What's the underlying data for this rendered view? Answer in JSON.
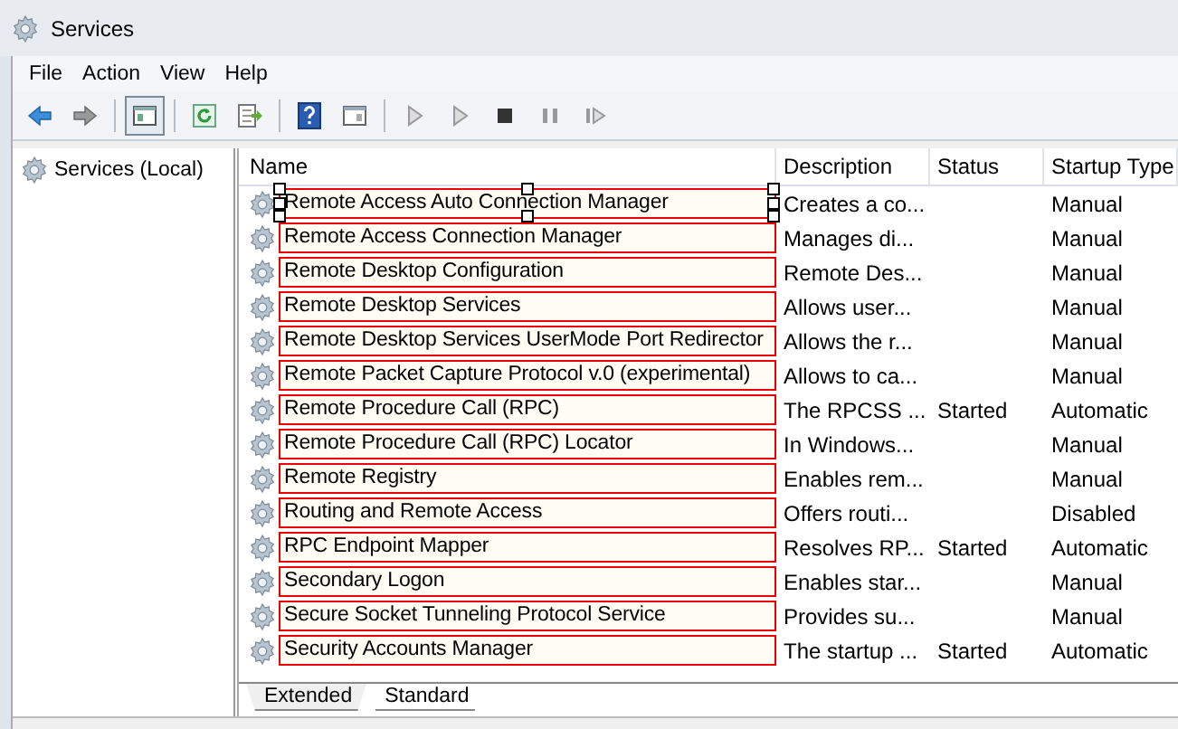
{
  "window": {
    "title": "Services"
  },
  "menu": [
    "File",
    "Action",
    "View",
    "Help"
  ],
  "toolbar": [
    {
      "kind": "back",
      "pressed": false
    },
    {
      "kind": "forward",
      "pressed": false
    },
    {
      "kind": "sep"
    },
    {
      "kind": "tree",
      "pressed": true
    },
    {
      "kind": "sep"
    },
    {
      "kind": "refresh",
      "pressed": false
    },
    {
      "kind": "export",
      "pressed": false
    },
    {
      "kind": "sep"
    },
    {
      "kind": "help",
      "pressed": false
    },
    {
      "kind": "panel",
      "pressed": false
    },
    {
      "kind": "sep"
    },
    {
      "kind": "play",
      "pressed": false
    },
    {
      "kind": "play",
      "pressed": false
    },
    {
      "kind": "stop",
      "pressed": false
    },
    {
      "kind": "pause",
      "pressed": false
    },
    {
      "kind": "restart",
      "pressed": false
    }
  ],
  "sidebar": {
    "items": [
      {
        "label": "Services (Local)",
        "selected": false
      }
    ]
  },
  "table": {
    "columns": [
      "Name",
      "Description",
      "Status",
      "Startup Type"
    ],
    "rows": [
      {
        "name": "Remote Access Auto Connection Manager",
        "description": "Creates a co...",
        "status": "",
        "startup": "Manual",
        "outlined": true,
        "selected": true
      },
      {
        "name": "Remote Access Connection Manager",
        "description": "Manages di...",
        "status": "",
        "startup": "Manual",
        "outlined": true,
        "selected": false
      },
      {
        "name": "Remote Desktop Configuration",
        "description": "Remote Des...",
        "status": "",
        "startup": "Manual",
        "outlined": true,
        "selected": false
      },
      {
        "name": "Remote Desktop Services",
        "description": "Allows user...",
        "status": "",
        "startup": "Manual",
        "outlined": true,
        "selected": false
      },
      {
        "name": "Remote Desktop Services UserMode Port Redirector",
        "description": "Allows the r...",
        "status": "",
        "startup": "Manual",
        "outlined": true,
        "selected": false
      },
      {
        "name": "Remote Packet Capture Protocol v.0 (experimental)",
        "description": "Allows to ca...",
        "status": "",
        "startup": "Manual",
        "outlined": true,
        "selected": false
      },
      {
        "name": "Remote Procedure Call (RPC)",
        "description": "The RPCSS ...",
        "status": "Started",
        "startup": "Automatic",
        "outlined": true,
        "selected": false
      },
      {
        "name": "Remote Procedure Call (RPC) Locator",
        "description": "In Windows...",
        "status": "",
        "startup": "Manual",
        "outlined": true,
        "selected": false
      },
      {
        "name": "Remote Registry",
        "description": "Enables rem...",
        "status": "",
        "startup": "Manual",
        "outlined": true,
        "selected": false
      },
      {
        "name": "Routing and Remote Access",
        "description": "Offers routi...",
        "status": "",
        "startup": "Disabled",
        "outlined": true,
        "selected": false
      },
      {
        "name": "RPC Endpoint Mapper",
        "description": "Resolves RP...",
        "status": "Started",
        "startup": "Automatic",
        "outlined": true,
        "selected": false
      },
      {
        "name": "Secondary Logon",
        "description": "Enables star...",
        "status": "",
        "startup": "Manual",
        "outlined": true,
        "selected": false
      },
      {
        "name": "Secure Socket Tunneling Protocol Service",
        "description": "Provides su...",
        "status": "",
        "startup": "Manual",
        "outlined": true,
        "selected": false
      },
      {
        "name": "Security Accounts Manager",
        "description": "The startup ...",
        "status": "Started",
        "startup": "Automatic",
        "outlined": true,
        "selected": false
      }
    ]
  },
  "tabs": [
    {
      "label": "Extended",
      "selected": false
    },
    {
      "label": "Standard",
      "selected": true
    }
  ]
}
